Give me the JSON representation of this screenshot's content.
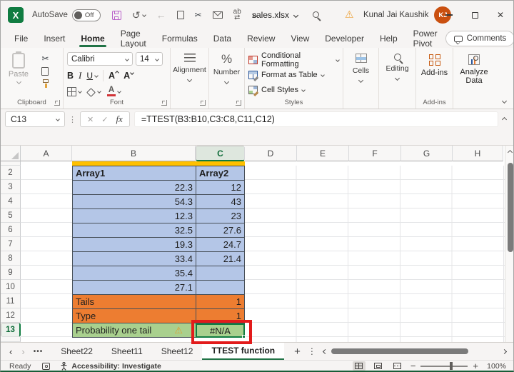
{
  "window": {
    "autosave_label": "AutoSave",
    "autosave_state": "Off",
    "filename": "sales.xlsx",
    "user_name": "Kunal Jai Kaushik",
    "user_initials": "KJ"
  },
  "icons": {
    "excel_x": "X",
    "undo": "↺",
    "back": "←",
    "cut": "✂",
    "find_replace": "ab",
    "swap_arrows": "⇄",
    "more_chevrons": "»",
    "close": "✕",
    "warning": "⚠",
    "ellipsis_v": "⋮",
    "tabs_overflow": "•••",
    "nav_left": "‹",
    "nav_right": "›",
    "plus": "+",
    "minus": "−",
    "percent": "%",
    "fx": "fx",
    "cancel": "✕",
    "enter": "✓",
    "letter_a": "A"
  },
  "ribbon": {
    "tabs": [
      "File",
      "Insert",
      "Home",
      "Page Layout",
      "Formulas",
      "Data",
      "Review",
      "View",
      "Developer",
      "Help",
      "Power Pivot"
    ],
    "active_tab": "Home",
    "comments_label": "Comments",
    "clipboard": {
      "paste_label": "Paste",
      "group_label": "Clipboard"
    },
    "font": {
      "font_name": "Calibri",
      "font_size": "14",
      "bold": "B",
      "italic": "I",
      "underline": "U",
      "group_label": "Font"
    },
    "alignment_label": "Alignment",
    "number_label": "Number",
    "styles": {
      "conditional": "Conditional Formatting",
      "format_table": "Format as Table",
      "cell_styles": "Cell Styles",
      "group_label": "Styles"
    },
    "cells_label": "Cells",
    "editing_label": "Editing",
    "addins": {
      "addins_label": "Add-ins",
      "analyze_label": "Analyze Data",
      "group_label": "Add-ins"
    }
  },
  "formula_bar": {
    "name_box": "C13",
    "formula": "=TTEST(B3:B10,C3:C8,C11,C12)"
  },
  "grid": {
    "columns": [
      "A",
      "B",
      "C",
      "D",
      "E",
      "F",
      "G",
      "H"
    ],
    "selected_column": "C",
    "selected_cell": "C13",
    "rows": [
      {
        "n": "2",
        "b": "Array1",
        "c": "Array2"
      },
      {
        "n": "3",
        "b": "22.3",
        "c": "12"
      },
      {
        "n": "4",
        "b": "54.3",
        "c": "43"
      },
      {
        "n": "5",
        "b": "12.3",
        "c": "23"
      },
      {
        "n": "6",
        "b": "32.5",
        "c": "27.6"
      },
      {
        "n": "7",
        "b": "19.3",
        "c": "24.7"
      },
      {
        "n": "8",
        "b": "33.4",
        "c": "21.4"
      },
      {
        "n": "9",
        "b": "35.4",
        "c": ""
      },
      {
        "n": "10",
        "b": "27.1",
        "c": ""
      },
      {
        "n": "11",
        "b": "Tails",
        "c": "1"
      },
      {
        "n": "12",
        "b": "Type",
        "c": "1"
      },
      {
        "n": "13",
        "b": "Probability one tail",
        "c": "#N/A"
      }
    ]
  },
  "sheet_tabs": {
    "tabs": [
      "Sheet22",
      "Sheet11",
      "Sheet12",
      "TTEST function"
    ],
    "active_tab": "TTEST function"
  },
  "status_bar": {
    "mode": "Ready",
    "accessibility": "Accessibility: Investigate",
    "zoom_level": "100%"
  },
  "colors": {
    "accent_green": "#107C41",
    "blue_fill": "#B4C6E7",
    "orange_fill": "#ED7D31",
    "green_fill": "#A9D08E",
    "yellow_fill": "#FFC000",
    "annotation_red": "#E21B1B",
    "avatar_orange": "#CA5010"
  }
}
